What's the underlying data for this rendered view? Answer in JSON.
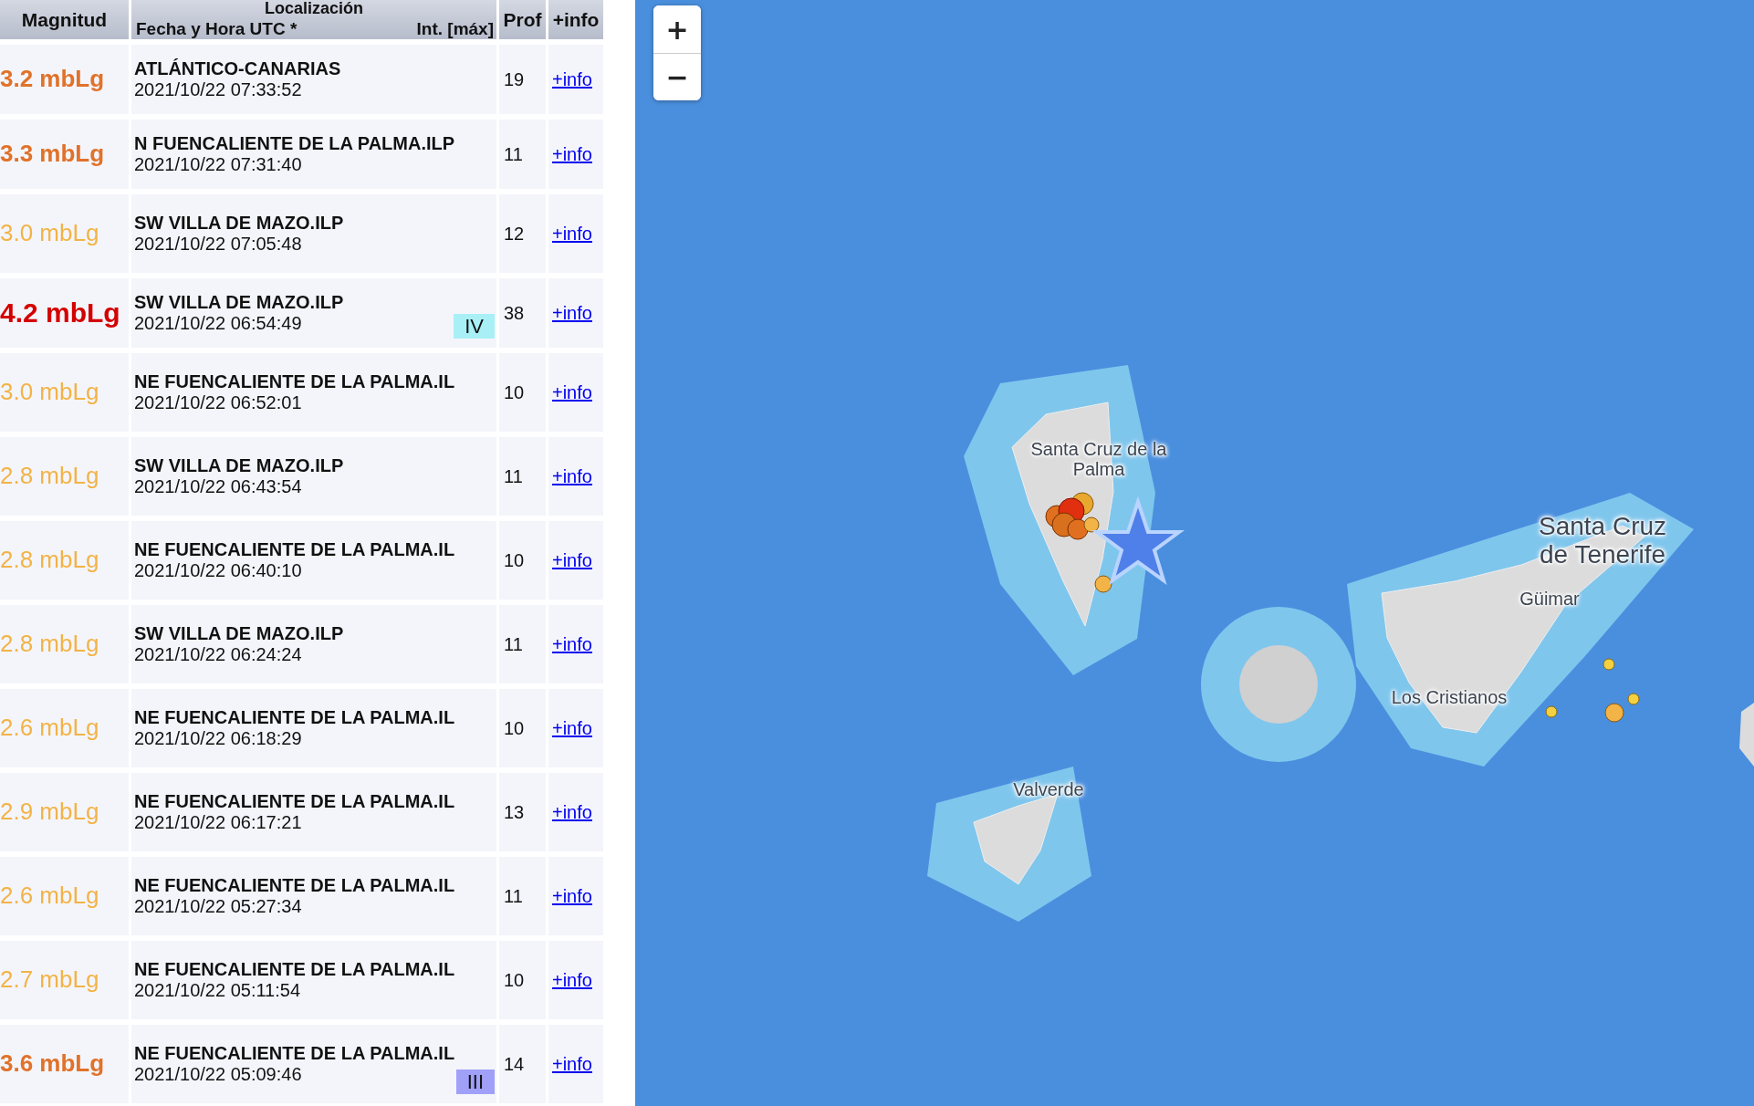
{
  "table": {
    "columns": {
      "magnitude": "Magnitud",
      "location": "Localización",
      "datetime": "Fecha y Hora UTC *",
      "intensity": "Int. [máx]",
      "depth": "Prof",
      "info": "+info"
    },
    "rows": [
      {
        "magnitude": "3.2 mbLg",
        "color": "#e0722a",
        "location": "ATLÁNTICO-CANARIAS",
        "datetime": "2021/10/22 07:33:52",
        "depth": "19",
        "info": "+info"
      },
      {
        "magnitude": "3.3 mbLg",
        "color": "#e0722a",
        "location": "N FUENCALIENTE DE LA PALMA.ILP",
        "datetime": "2021/10/22 07:31:40",
        "depth": "11",
        "info": "+info"
      },
      {
        "magnitude": "3.0 mbLg",
        "color": "#f2b347",
        "location": "SW VILLA DE MAZO.ILP",
        "datetime": "2021/10/22 07:05:48",
        "depth": "12",
        "info": "+info"
      },
      {
        "magnitude": "4.2 mbLg",
        "color": "#d40000",
        "location": "SW VILLA DE MAZO.ILP",
        "datetime": "2021/10/22 06:54:49",
        "intensity": {
          "label": "IV",
          "color": "#a8f0f6"
        },
        "depth": "38",
        "info": "+info"
      },
      {
        "magnitude": "3.0 mbLg",
        "color": "#f2b347",
        "location": "NE FUENCALIENTE DE LA PALMA.IL",
        "datetime": "2021/10/22 06:52:01",
        "depth": "10",
        "info": "+info"
      },
      {
        "magnitude": "2.8 mbLg",
        "color": "#f2b347",
        "location": "SW VILLA DE MAZO.ILP",
        "datetime": "2021/10/22 06:43:54",
        "depth": "11",
        "info": "+info"
      },
      {
        "magnitude": "2.8 mbLg",
        "color": "#f2b347",
        "location": "NE FUENCALIENTE DE LA PALMA.IL",
        "datetime": "2021/10/22 06:40:10",
        "depth": "10",
        "info": "+info"
      },
      {
        "magnitude": "2.8 mbLg",
        "color": "#f2b347",
        "location": "SW VILLA DE MAZO.ILP",
        "datetime": "2021/10/22 06:24:24",
        "depth": "11",
        "info": "+info"
      },
      {
        "magnitude": "2.6 mbLg",
        "color": "#f2b347",
        "location": "NE FUENCALIENTE DE LA PALMA.IL",
        "datetime": "2021/10/22 06:18:29",
        "depth": "10",
        "info": "+info"
      },
      {
        "magnitude": "2.9 mbLg",
        "color": "#f2b347",
        "location": "NE FUENCALIENTE DE LA PALMA.IL",
        "datetime": "2021/10/22 06:17:21",
        "depth": "13",
        "info": "+info"
      },
      {
        "magnitude": "2.6 mbLg",
        "color": "#f2b347",
        "location": "NE FUENCALIENTE DE LA PALMA.IL",
        "datetime": "2021/10/22 05:27:34",
        "depth": "11",
        "info": "+info"
      },
      {
        "magnitude": "2.7 mbLg",
        "color": "#f2b347",
        "location": "NE FUENCALIENTE DE LA PALMA.IL",
        "datetime": "2021/10/22 05:11:54",
        "depth": "10",
        "info": "+info"
      },
      {
        "magnitude": "3.6 mbLg",
        "color": "#e0722a",
        "location": "NE FUENCALIENTE DE LA PALMA.IL",
        "datetime": "2021/10/22 05:09:46",
        "intensity": {
          "label": "III",
          "color": "#a0a0f8"
        },
        "depth": "14",
        "info": "+info"
      }
    ]
  },
  "map": {
    "zoom_in": "+",
    "zoom_out": "−",
    "labels": [
      {
        "text": "Santa Cruz de la Palma",
        "kind": "small"
      },
      {
        "text": "Santa Cruz de Tenerife",
        "kind": "large"
      },
      {
        "text": "Güimar",
        "kind": "small"
      },
      {
        "text": "Los Cristianos",
        "kind": "small"
      },
      {
        "text": "Valverde",
        "kind": "small"
      }
    ]
  }
}
